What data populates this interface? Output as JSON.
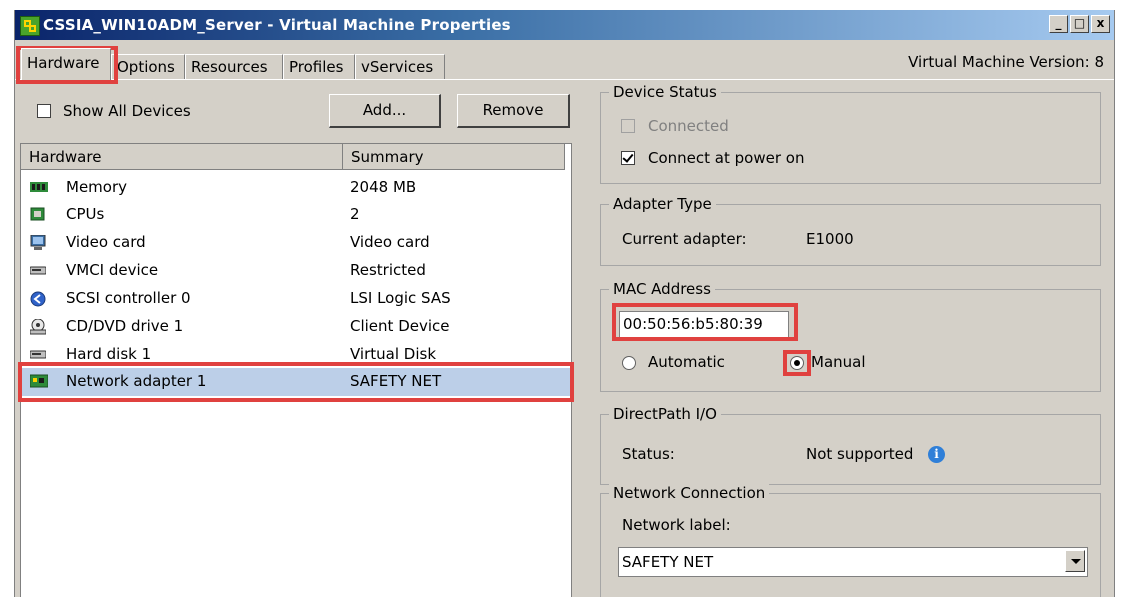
{
  "window": {
    "title": "CSSIA_WIN10ADM_Server - Virtual Machine Properties",
    "controls": {
      "minimize": "_",
      "maximize": "□",
      "close": "x"
    }
  },
  "tabs": [
    {
      "label": "Hardware",
      "active": true
    },
    {
      "label": "Options"
    },
    {
      "label": "Resources"
    },
    {
      "label": "Profiles"
    },
    {
      "label": "vServices"
    }
  ],
  "vm_version": "Virtual Machine Version: 8",
  "left": {
    "show_all_devices": "Show All Devices",
    "add_button": "Add...",
    "remove_button": "Remove",
    "columns": {
      "hardware": "Hardware",
      "summary": "Summary"
    },
    "devices": [
      {
        "name": "Memory",
        "summary": "2048 MB",
        "icon": "memory-icon"
      },
      {
        "name": "CPUs",
        "summary": "2",
        "icon": "cpu-icon"
      },
      {
        "name": "Video card",
        "summary": "Video card",
        "icon": "monitor-icon"
      },
      {
        "name": "VMCI device",
        "summary": "Restricted",
        "icon": "vmci-icon"
      },
      {
        "name": "SCSI controller 0",
        "summary": "LSI Logic SAS",
        "icon": "scsi-icon"
      },
      {
        "name": "CD/DVD drive 1",
        "summary": "Client Device",
        "icon": "cdrom-icon"
      },
      {
        "name": "Hard disk 1",
        "summary": "Virtual Disk",
        "icon": "harddisk-icon"
      },
      {
        "name": "Network adapter 1",
        "summary": "SAFETY NET",
        "icon": "network-adapter-icon",
        "selected": true
      }
    ]
  },
  "right": {
    "device_status": {
      "title": "Device Status",
      "connected": "Connected",
      "connect_at_power_on": "Connect at power on"
    },
    "adapter_type": {
      "title": "Adapter Type",
      "label": "Current adapter:",
      "value": "E1000"
    },
    "mac_address": {
      "title": "MAC Address",
      "value": "00:50:56:b5:80:39",
      "automatic": "Automatic",
      "manual": "Manual"
    },
    "directpath": {
      "title": "DirectPath I/O",
      "label": "Status:",
      "value": "Not supported",
      "info_glyph": "i"
    },
    "network_connection": {
      "title": "Network Connection",
      "label": "Network label:",
      "value": "SAFETY NET"
    }
  },
  "colors": {
    "highlight": "#e0413f",
    "selection": "#bccfe8",
    "window_bg": "#d4d0c8",
    "titlebar": "#0a246a"
  }
}
